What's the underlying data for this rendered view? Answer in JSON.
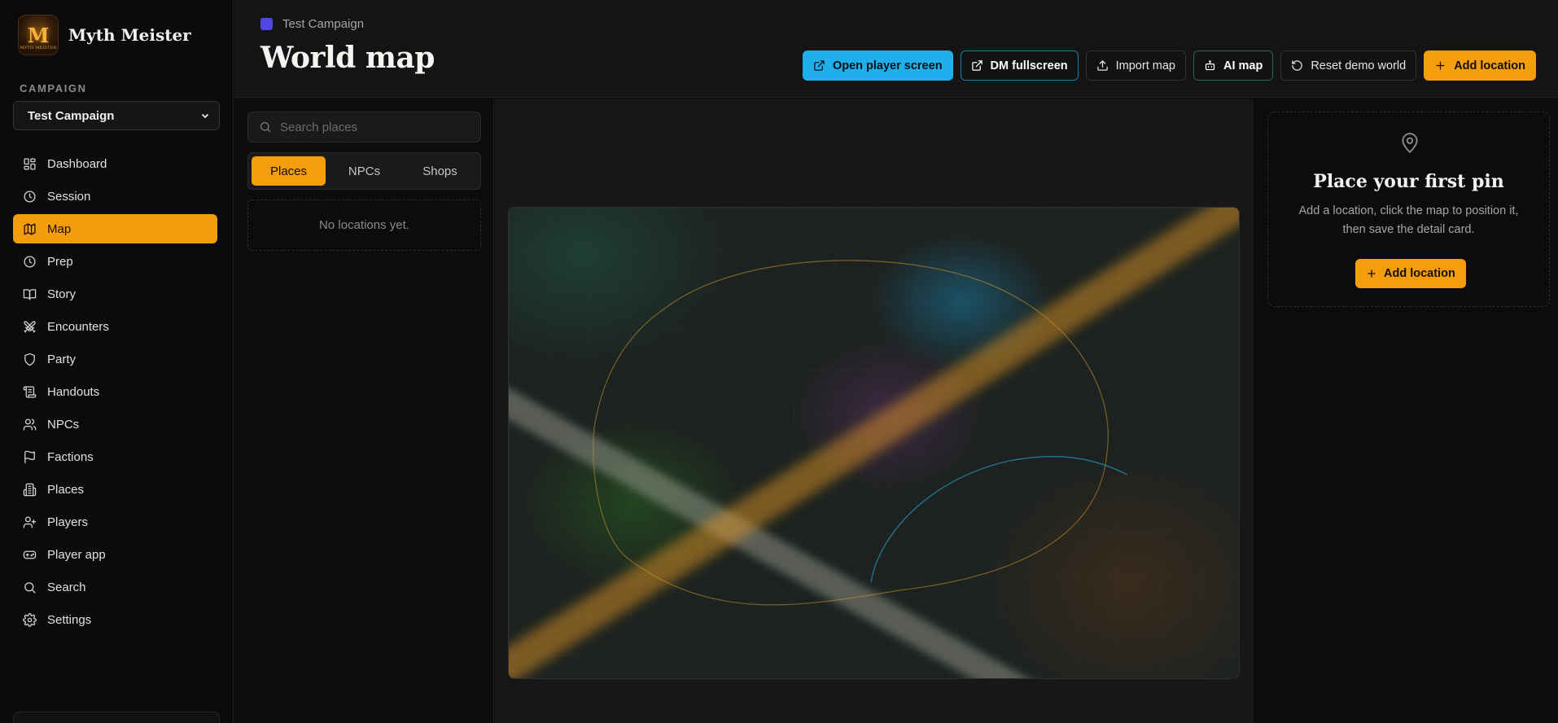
{
  "app": {
    "brand_name": "Myth Meister",
    "logo_letter": "M",
    "logo_subtext": "MYTH MEISTER"
  },
  "sidebar": {
    "campaign_label": "CAMPAIGN",
    "campaign_selected": "Test Campaign",
    "items": [
      {
        "label": "Dashboard",
        "icon": "dashboard-icon"
      },
      {
        "label": "Session",
        "icon": "clock-icon"
      },
      {
        "label": "Map",
        "icon": "map-icon",
        "active": true
      },
      {
        "label": "Prep",
        "icon": "clock-icon"
      },
      {
        "label": "Story",
        "icon": "book-icon"
      },
      {
        "label": "Encounters",
        "icon": "swords-icon"
      },
      {
        "label": "Party",
        "icon": "shield-icon"
      },
      {
        "label": "Handouts",
        "icon": "scroll-icon"
      },
      {
        "label": "NPCs",
        "icon": "users-icon"
      },
      {
        "label": "Factions",
        "icon": "flag-icon"
      },
      {
        "label": "Places",
        "icon": "building-icon"
      },
      {
        "label": "Players",
        "icon": "user-plus-icon"
      },
      {
        "label": "Player app",
        "icon": "gamepad-icon"
      },
      {
        "label": "Search",
        "icon": "search-icon"
      },
      {
        "label": "Settings",
        "icon": "gear-icon"
      }
    ]
  },
  "header": {
    "breadcrumb": "Test Campaign",
    "breadcrumb_color": "#4f46e5",
    "title": "World map",
    "buttons": {
      "open_player_screen": "Open player screen",
      "dm_fullscreen": "DM fullscreen",
      "import_map": "Import map",
      "ai_map": "AI map",
      "reset_demo_world": "Reset demo world",
      "add_location": "Add location"
    }
  },
  "left_panel": {
    "search_placeholder": "Search places",
    "tabs": [
      {
        "label": "Places",
        "active": true
      },
      {
        "label": "NPCs",
        "active": false
      },
      {
        "label": "Shops",
        "active": false
      }
    ],
    "empty_text": "No locations yet."
  },
  "right_panel": {
    "title": "Place your first pin",
    "text": "Add a location, click the map to position it, then save the detail card.",
    "button": "Add location"
  },
  "colors": {
    "accent": "#f49d0d",
    "cyan": "#1fb0ec",
    "background": "#0c0c0c"
  }
}
